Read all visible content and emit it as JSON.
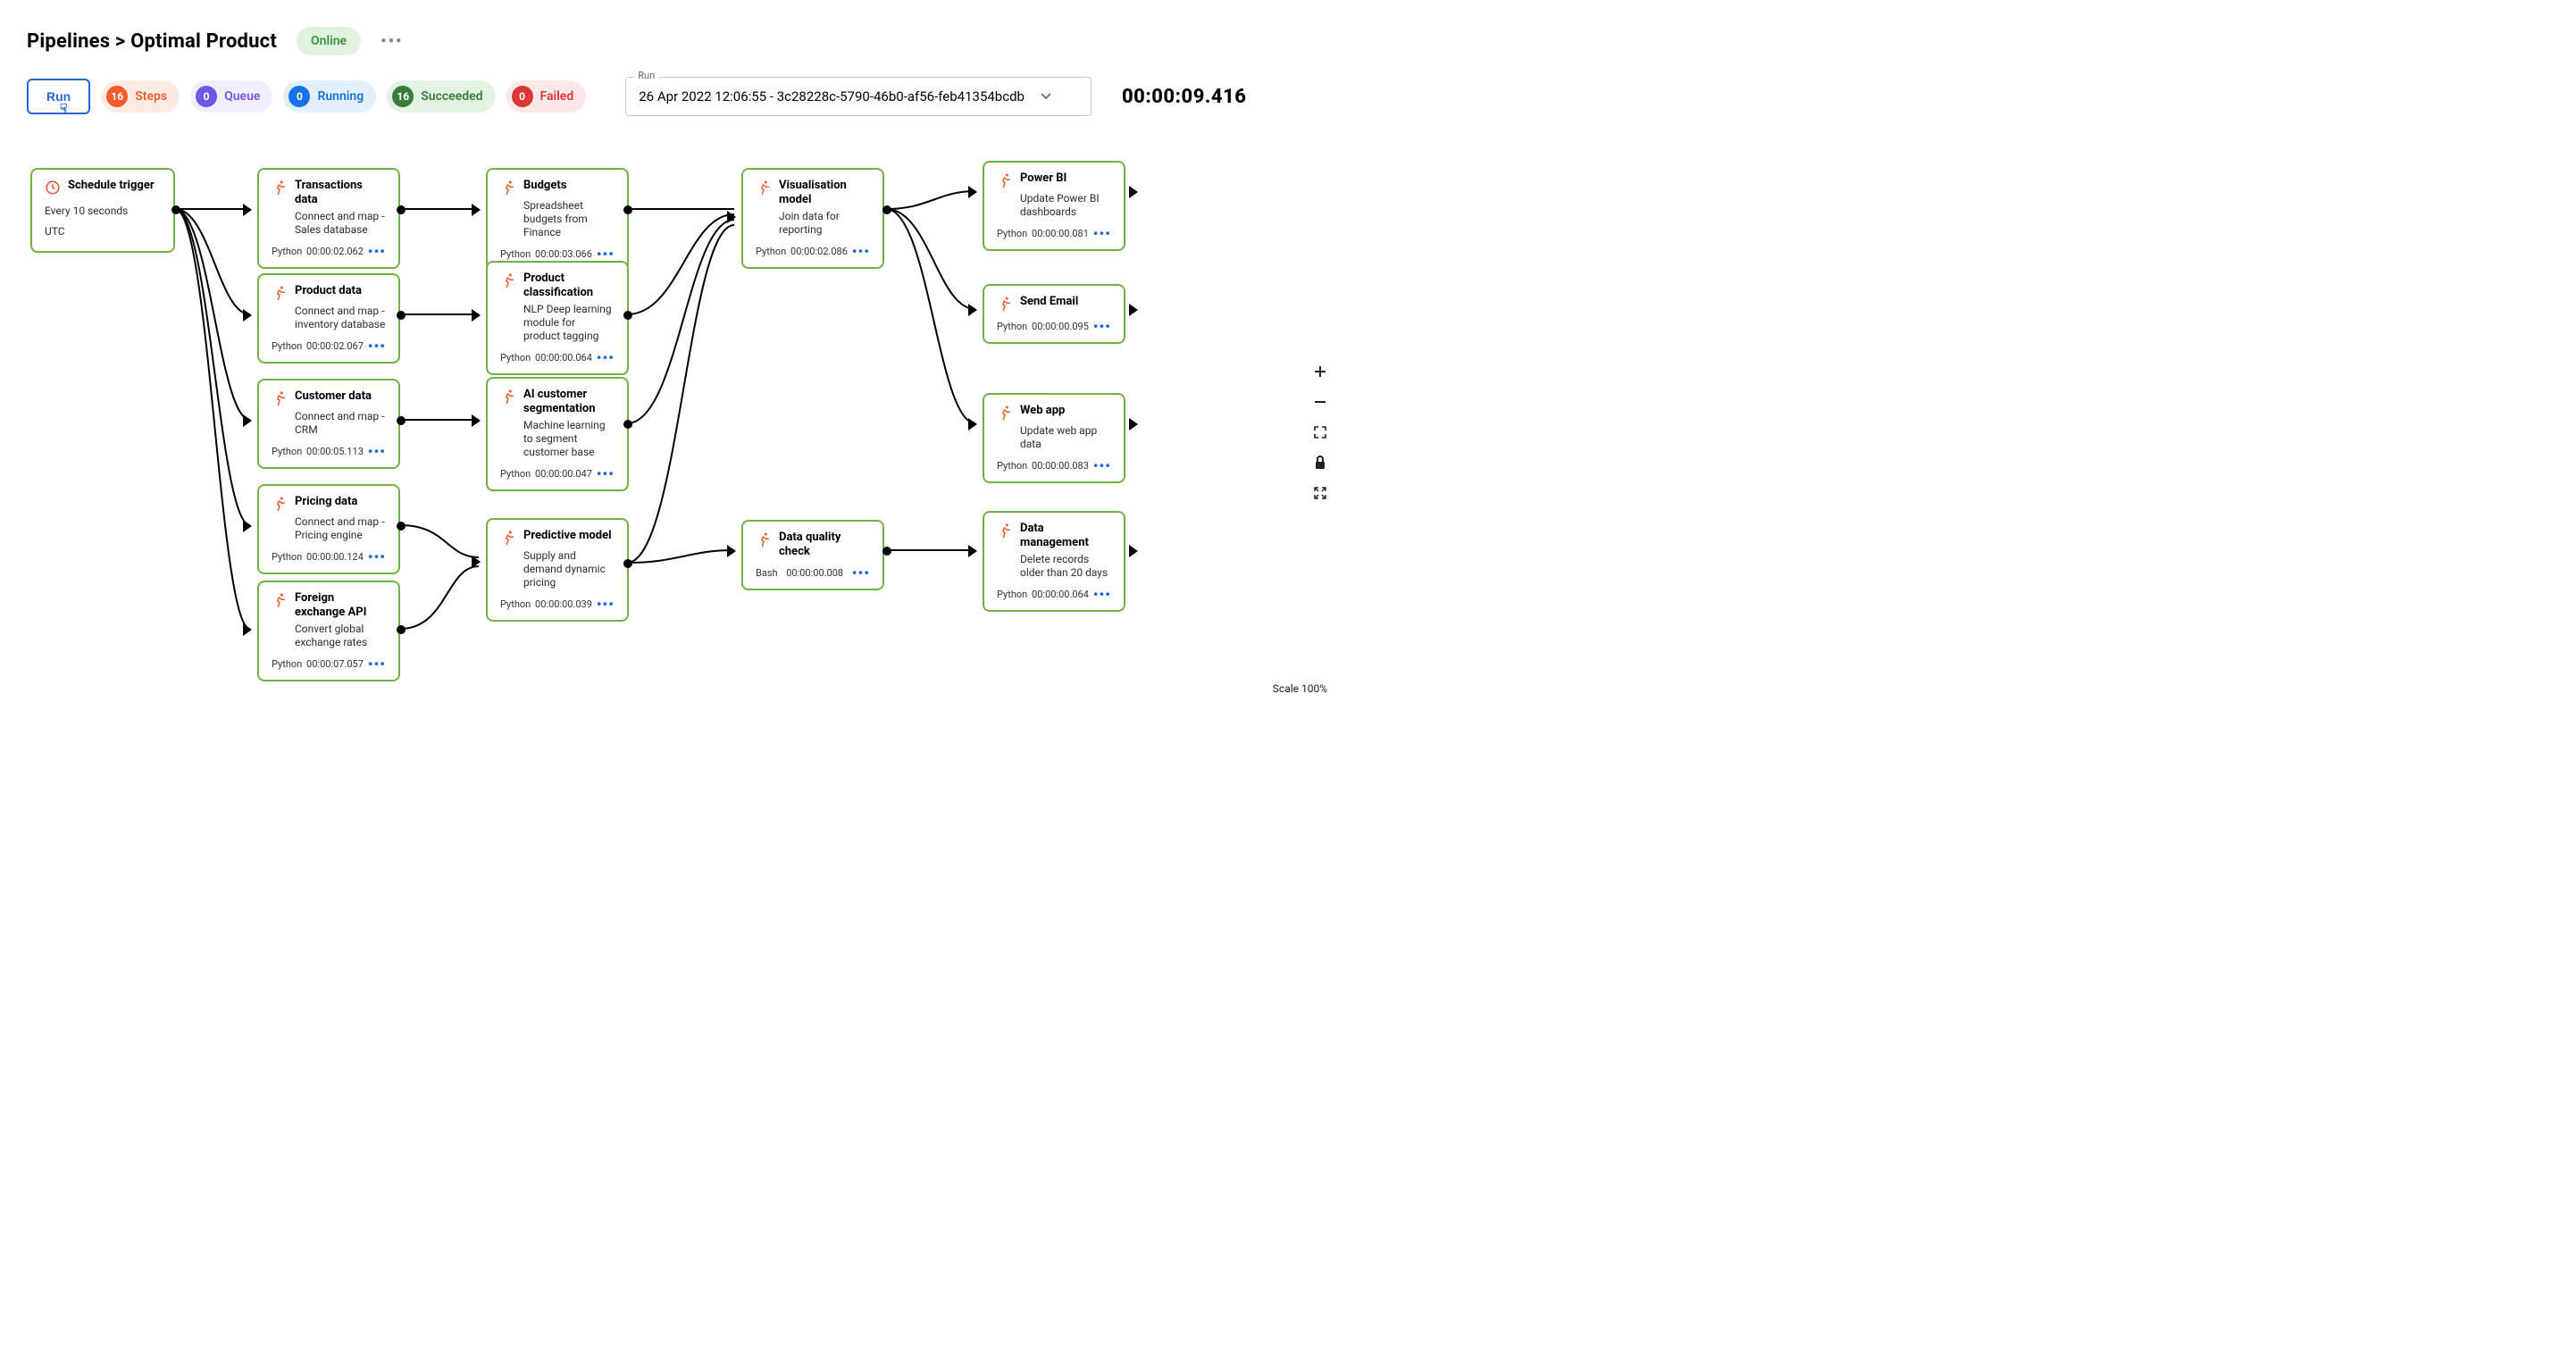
{
  "header": {
    "breadcrumb": "Pipelines > Optimal Product",
    "status": "Online"
  },
  "toolbar": {
    "run_label": "Run",
    "chips": {
      "steps": {
        "count": "16",
        "label": "Steps"
      },
      "queue": {
        "count": "0",
        "label": "Queue"
      },
      "running": {
        "count": "0",
        "label": "Running"
      },
      "succeeded": {
        "count": "16",
        "label": "Succeeded"
      },
      "failed": {
        "count": "0",
        "label": "Failed"
      }
    },
    "run_select_label": "Run",
    "run_select_value": "26 Apr 2022 12:06:55 - 3c28228c-5790-46b0-af56-feb41354bcdb",
    "elapsed": "00:00:09.416"
  },
  "nodes": {
    "trigger": {
      "title": "Schedule trigger",
      "line1": "Every 10 seconds",
      "line2": "UTC"
    },
    "transactions": {
      "title": "Transactions data",
      "desc": "Connect and map - Sales database",
      "lang": "Python",
      "time": "00:00:02.062"
    },
    "product": {
      "title": "Product data",
      "desc": "Connect and map - inventory database",
      "lang": "Python",
      "time": "00:00:02.067"
    },
    "customer": {
      "title": "Customer data",
      "desc": "Connect and map - CRM",
      "lang": "Python",
      "time": "00:00:05.113"
    },
    "pricing": {
      "title": "Pricing data",
      "desc": "Connect and map - Pricing engine",
      "lang": "Python",
      "time": "00:00:00.124"
    },
    "fx": {
      "title": "Foreign exchange API",
      "desc": "Convert global exchange rates",
      "lang": "Python",
      "time": "00:00:07.057"
    },
    "budgets": {
      "title": "Budgets",
      "desc": "Spreadsheet budgets from Finance",
      "lang": "Python",
      "time": "00:00:03.066"
    },
    "classification": {
      "title": "Product classification",
      "desc": "NLP Deep learning module for product tagging",
      "lang": "Python",
      "time": "00:00:00.064"
    },
    "segmentation": {
      "title": "AI customer segmentation",
      "desc": "Machine learning to segment customer base",
      "lang": "Python",
      "time": "00:00:00.047"
    },
    "predictive": {
      "title": "Predictive model",
      "desc": "Supply and demand dynamic pricing",
      "lang": "Python",
      "time": "00:00:00.039"
    },
    "viz": {
      "title": "Visualisation model",
      "desc": "Join data for reporting",
      "lang": "Python",
      "time": "00:00:02.086"
    },
    "dqc": {
      "title": "Data quality check",
      "desc": "",
      "lang": "Bash",
      "time": "00:00:00.008"
    },
    "powerbi": {
      "title": "Power BI",
      "desc": "Update Power BI dashboards",
      "lang": "Python",
      "time": "00:00:00.081"
    },
    "email": {
      "title": "Send Email",
      "desc": "",
      "lang": "Python",
      "time": "00:00:00.095"
    },
    "webapp": {
      "title": "Web app",
      "desc": "Update web app data",
      "lang": "Python",
      "time": "00:00:00.083"
    },
    "datamgmt": {
      "title": "Data management",
      "desc": "Delete records older than 20 days",
      "lang": "Python",
      "time": "00:00:00.064"
    }
  },
  "scale_label": "Scale 100%"
}
